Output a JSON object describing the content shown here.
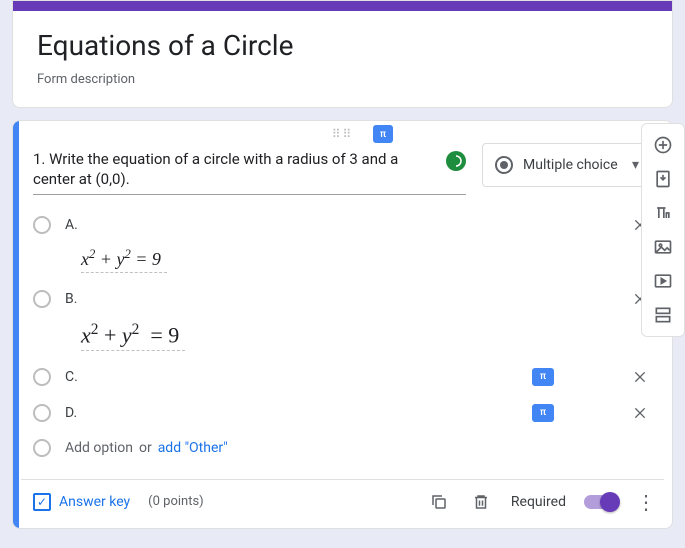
{
  "form": {
    "title": "Equations of a Circle",
    "description": "Form description"
  },
  "question": {
    "text": "1. Write the equation of a circle with a radius of 3 and a center at (0,0).",
    "type_label": "Multiple choice"
  },
  "options": {
    "a": "A.",
    "b": "B.",
    "c": "C.",
    "d": "D.",
    "eq_a": "x² + y² = 9",
    "eq_b": "x²  + y²   = 9"
  },
  "add": {
    "option": "Add option",
    "or": "or",
    "other": "add \"Other\""
  },
  "footer": {
    "answer_key": "Answer key",
    "points": "(0 points)",
    "required": "Required"
  }
}
